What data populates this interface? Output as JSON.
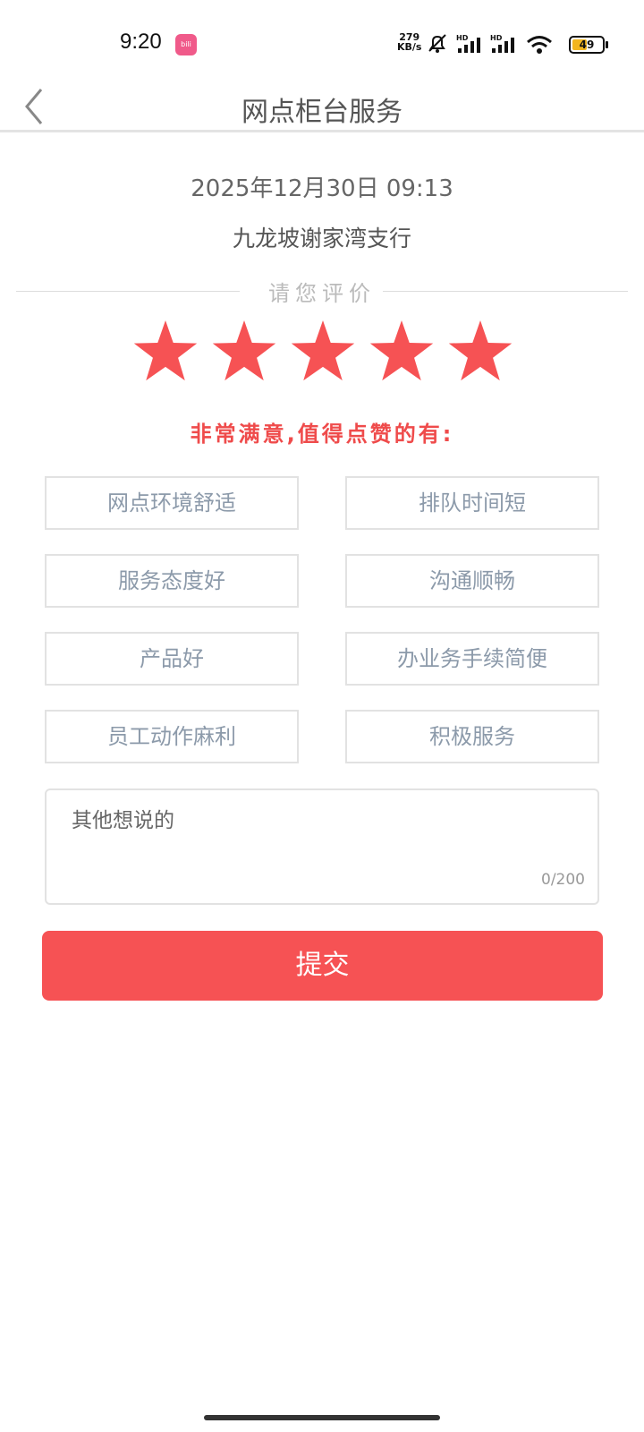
{
  "status_bar": {
    "time": "9:20",
    "app_icon_text": "bilibili",
    "net_speed_value": "279",
    "net_speed_unit": "KB/s",
    "signal_label_1": "HD",
    "signal_label_2": "HD",
    "battery": "49"
  },
  "header": {
    "title": "网点柜台服务"
  },
  "visit": {
    "datetime": "2025年12月30日 09:13",
    "branch": "九龙坡谢家湾支行"
  },
  "rating": {
    "prompt": "请您评价",
    "stars_selected": 5,
    "stars_total": 5,
    "star_color": "#f65254",
    "result_text": "非常满意,值得点赞的有:"
  },
  "tags": [
    "网点环境舒适",
    "排队时间短",
    "服务态度好",
    "沟通顺畅",
    "产品好",
    "办业务手续简便",
    "员工动作麻利",
    "积极服务"
  ],
  "comment": {
    "placeholder": "其他想说的",
    "counter": "0/200"
  },
  "submit_label": "提交",
  "accent_color": "#f65254"
}
